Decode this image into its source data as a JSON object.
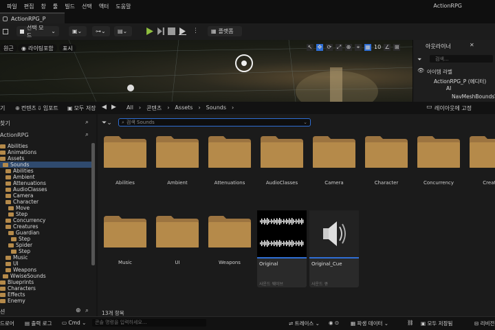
{
  "menu": [
    "파일",
    "편집",
    "창",
    "툴",
    "빌드",
    "선택",
    "액터",
    "도움말"
  ],
  "app_title": "ActionRPG",
  "document_tab": "ActionRPG_P",
  "toolbar": {
    "select_mode": "선택 모드",
    "platforms": "플랫폼"
  },
  "viewport": {
    "perspective": "원근",
    "lit": "라이팅포함",
    "show": "표시",
    "grid_value": "10"
  },
  "outliner": {
    "title": "아웃라이너",
    "search_placeholder": "검색...",
    "column_label": "아이템 라벨",
    "rows": [
      "ActionRPG_P (에디터)",
      "AI",
      "NavMeshBoundsV"
    ]
  },
  "cb_tabs": {
    "browser": "기",
    "content": "컨텐츠",
    "import": "임포트",
    "save_all": "모두 저장"
  },
  "breadcrumb": [
    "All",
    "콘텐츠",
    "Assets",
    "Sounds"
  ],
  "layout_lock": "레이아웃에 고정",
  "left_panel": {
    "favorites": "찾기",
    "project": "ActionRPG",
    "collections": "션"
  },
  "search_assets_placeholder": "검색 Sounds",
  "tree": [
    {
      "label": "Abilities",
      "depth": 0,
      "sel": false
    },
    {
      "label": "Animations",
      "depth": 0,
      "sel": false
    },
    {
      "label": "Assets",
      "depth": 0,
      "sel": false
    },
    {
      "label": "Sounds",
      "depth": 1,
      "sel": true
    },
    {
      "label": "Abilities",
      "depth": 2,
      "sel": false
    },
    {
      "label": "Ambient",
      "depth": 2,
      "sel": false
    },
    {
      "label": "Attenuations",
      "depth": 2,
      "sel": false
    },
    {
      "label": "AudioClasses",
      "depth": 2,
      "sel": false
    },
    {
      "label": "Camera",
      "depth": 2,
      "sel": false
    },
    {
      "label": "Character",
      "depth": 2,
      "sel": false
    },
    {
      "label": "Move",
      "depth": 3,
      "sel": false
    },
    {
      "label": "Step",
      "depth": 3,
      "sel": false
    },
    {
      "label": "Concurrency",
      "depth": 2,
      "sel": false
    },
    {
      "label": "Creatures",
      "depth": 2,
      "sel": false
    },
    {
      "label": "Guardian",
      "depth": 3,
      "sel": false
    },
    {
      "label": "Step",
      "depth": 4,
      "sel": false
    },
    {
      "label": "Spider",
      "depth": 3,
      "sel": false
    },
    {
      "label": "Step",
      "depth": 4,
      "sel": false
    },
    {
      "label": "Music",
      "depth": 2,
      "sel": false
    },
    {
      "label": "UI",
      "depth": 2,
      "sel": false
    },
    {
      "label": "Weapons",
      "depth": 2,
      "sel": false
    },
    {
      "label": "WwiseSounds",
      "depth": 1,
      "sel": false
    },
    {
      "label": "Blueprints",
      "depth": 0,
      "sel": false
    },
    {
      "label": "Characters",
      "depth": 0,
      "sel": false
    },
    {
      "label": "Effects",
      "depth": 0,
      "sel": false
    },
    {
      "label": "Enemy",
      "depth": 0,
      "sel": false
    }
  ],
  "folders_row1": [
    "Abilities",
    "Ambient",
    "Attenuations",
    "AudioClasses",
    "Camera",
    "Character",
    "Concurrency",
    "Creatu"
  ],
  "folders_row2": [
    "Music",
    "UI",
    "Weapons"
  ],
  "assets": [
    {
      "name": "Original",
      "type": "사운드 웨이브"
    },
    {
      "name": "Original_Cue",
      "type": "사운드 큐"
    }
  ],
  "item_count": "13개 항목",
  "status": {
    "drawer": "드로어",
    "output_log": "출력 로그",
    "cmd": "Cmd",
    "console_placeholder": "콘솔 명령을 입력하세요...",
    "trace": "트레이스",
    "derived_data": "파생 데이터",
    "save_all": "모두 저장됨",
    "revision": "리비전"
  },
  "colors": {
    "accent_blue": "#2f6fd6",
    "folder": "#b58a4a",
    "play_green": "#8fbf3f"
  }
}
